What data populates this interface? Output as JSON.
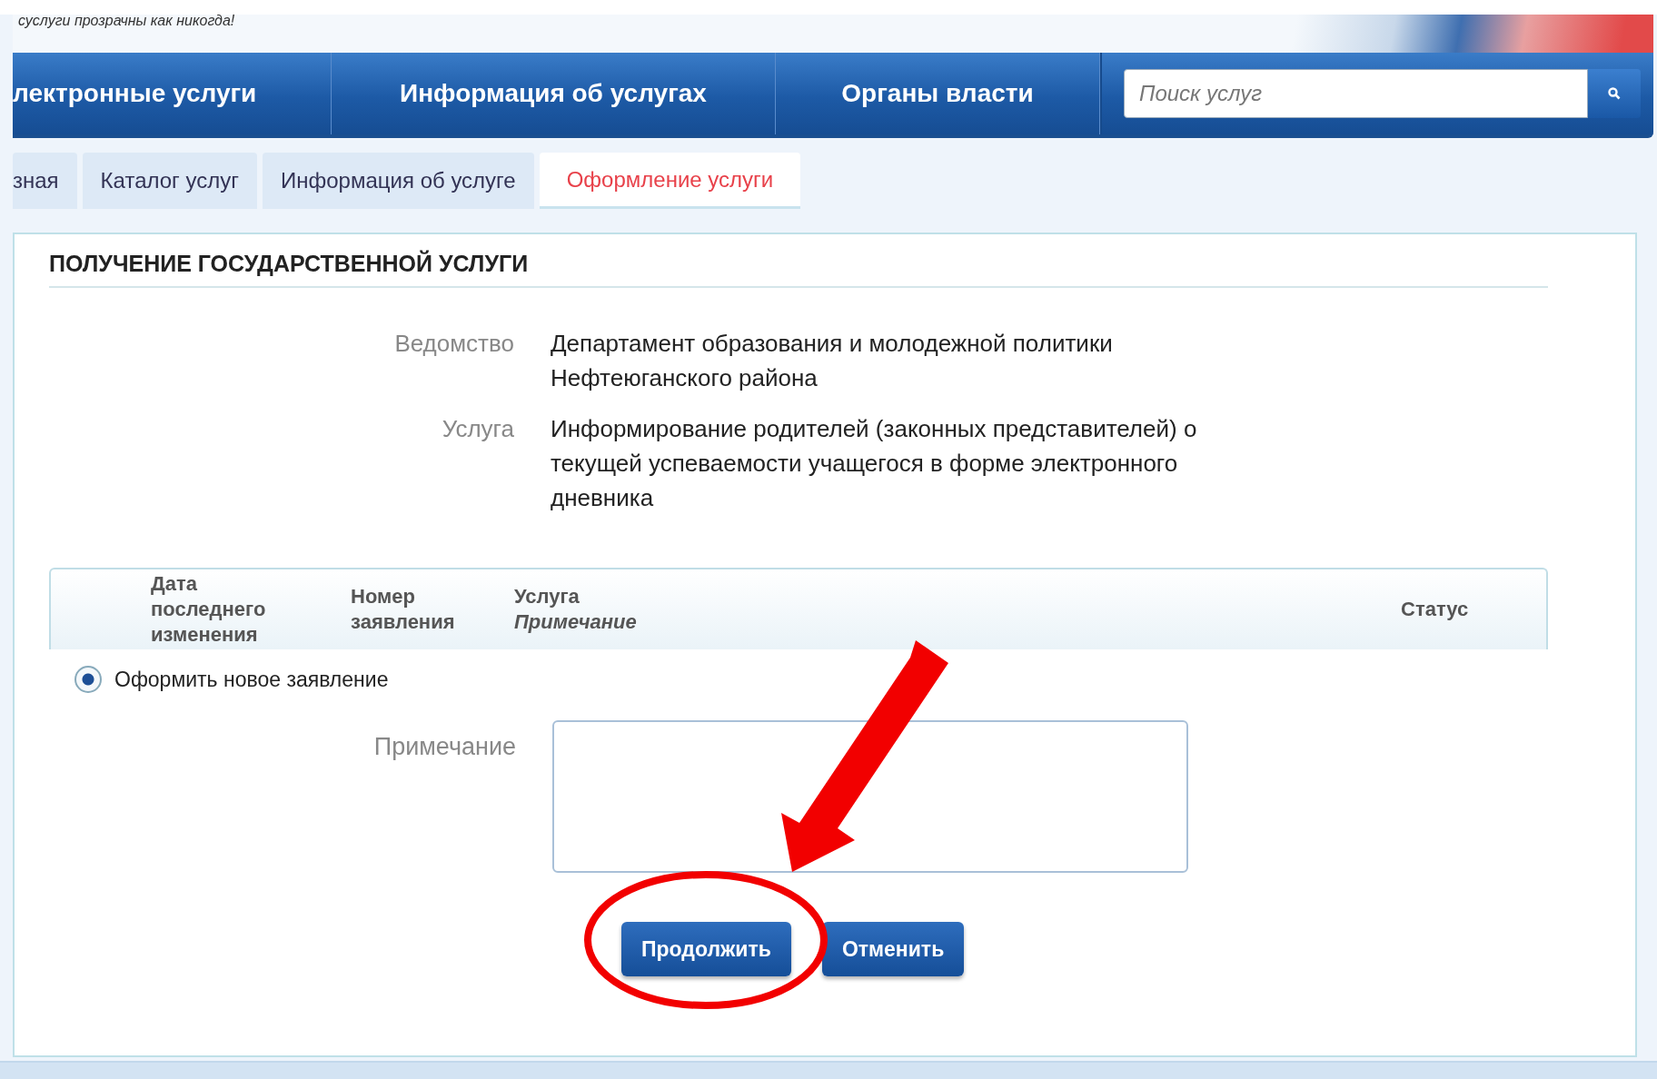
{
  "header": {
    "slogan": "суслуги прозрачны как никогда!"
  },
  "nav": {
    "items": [
      {
        "label": "лектронные услуги"
      },
      {
        "label": "Информация об услугах"
      },
      {
        "label": "Органы власти"
      }
    ],
    "search": {
      "placeholder": "Поиск услуг"
    }
  },
  "breadcrumbs": [
    {
      "label": "зная",
      "selected": false
    },
    {
      "label": "Каталог услуг",
      "selected": false
    },
    {
      "label": "Информация об услуге",
      "selected": false
    },
    {
      "label": "Оформление услуги",
      "selected": true
    }
  ],
  "section": {
    "title": "ПОЛУЧЕНИЕ ГОСУДАРСТВЕННОЙ УСЛУГИ",
    "details": [
      {
        "label": "Ведомство",
        "value": "Департамент образования и молодежной политики Нефтеюганского района"
      },
      {
        "label": "Услуга",
        "value": "Информирование родителей (законных представителей) о текущей успеваемости учащегося в форме электронного дневника"
      }
    ]
  },
  "table": {
    "columns": [
      {
        "label": "Дата последнего изменения"
      },
      {
        "label": "Номер заявления"
      },
      {
        "label": "Услуга",
        "sublabel": "Примечание"
      },
      {
        "label": "Статус"
      }
    ]
  },
  "new_request": {
    "label": "Оформить новое заявление",
    "selected": true
  },
  "note": {
    "label": "Примечание"
  },
  "buttons": [
    {
      "label": "Продолжить"
    },
    {
      "label": "Отменить"
    }
  ],
  "annotations": [
    {
      "kind": "arrow"
    },
    {
      "kind": "ellipse"
    }
  ]
}
